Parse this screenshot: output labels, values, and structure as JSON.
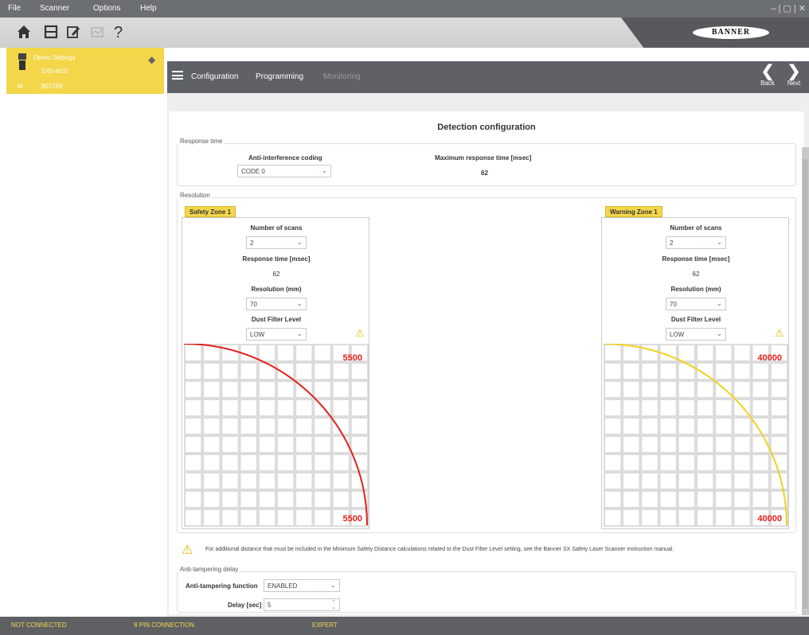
{
  "menu": {
    "file": "File",
    "scanner": "Scanner",
    "options": "Options",
    "help": "Help"
  },
  "window_controls": "– | ▢ | ✕",
  "toolbar": {
    "icons": [
      "home-icon",
      "save-icon",
      "edit-config-icon",
      "monitor-icon",
      "help-icon"
    ]
  },
  "brand": "BANNER",
  "device": {
    "name": "Demo Settings",
    "model": "SX5-M10",
    "id_label": "M",
    "serial": "807269"
  },
  "nav": {
    "configuration": "Configuration",
    "programming": "Programming",
    "monitoring": "Monitoring",
    "back": "Back",
    "next": "Next"
  },
  "page_title": "Detection configuration",
  "response_time": {
    "legend": "Response time",
    "anti_interference_label": "Anti-interference coding",
    "anti_interference_value": "CODE 0",
    "max_response_label": "Maximum response time [msec]",
    "max_response_value": "62"
  },
  "resolution": {
    "legend": "Resolution"
  },
  "safety_zone": {
    "tab": "Safety Zone 1",
    "scans_label": "Number of scans",
    "scans_value": "2",
    "resp_label": "Response time [msec]",
    "resp_value": "62",
    "res_label": "Resolution (mm)",
    "res_value": "70",
    "dust_label": "Dust Filter Level",
    "dust_value": "LOW",
    "range_top": "5500",
    "range_bottom": "5500",
    "arc_color": "#e3201b"
  },
  "warning_zone": {
    "tab": "Warning Zone 1",
    "scans_label": "Number of scans",
    "scans_value": "2",
    "resp_label": "Response time [msec]",
    "resp_value": "62",
    "res_label": "Resolution (mm)",
    "res_value": "70",
    "dust_label": "Dust Filter Level",
    "dust_value": "LOW",
    "range_top": "40000",
    "range_bottom": "40000",
    "arc_color": "#f2d11e"
  },
  "dust_note": "For additional distance that must be included in the Minimum Safety Distance calculations related to the Dust Filter Level setting, see the Banner SX Safety Laser Scanner instruction manual.",
  "anti_tampering": {
    "legend": "Anti-tampering delay",
    "function_label": "Anti-tampering function",
    "function_value": "ENABLED",
    "delay_label": "Delay [sec]",
    "delay_value": "5"
  },
  "status": {
    "connection": "NOT CONNECTED",
    "pin": "8 PIN CONNECTION",
    "mode": "EXPERT"
  },
  "colors": {
    "accent": "#f3d64a",
    "nav": "#5f6167",
    "status_text": "#f3d64a"
  }
}
